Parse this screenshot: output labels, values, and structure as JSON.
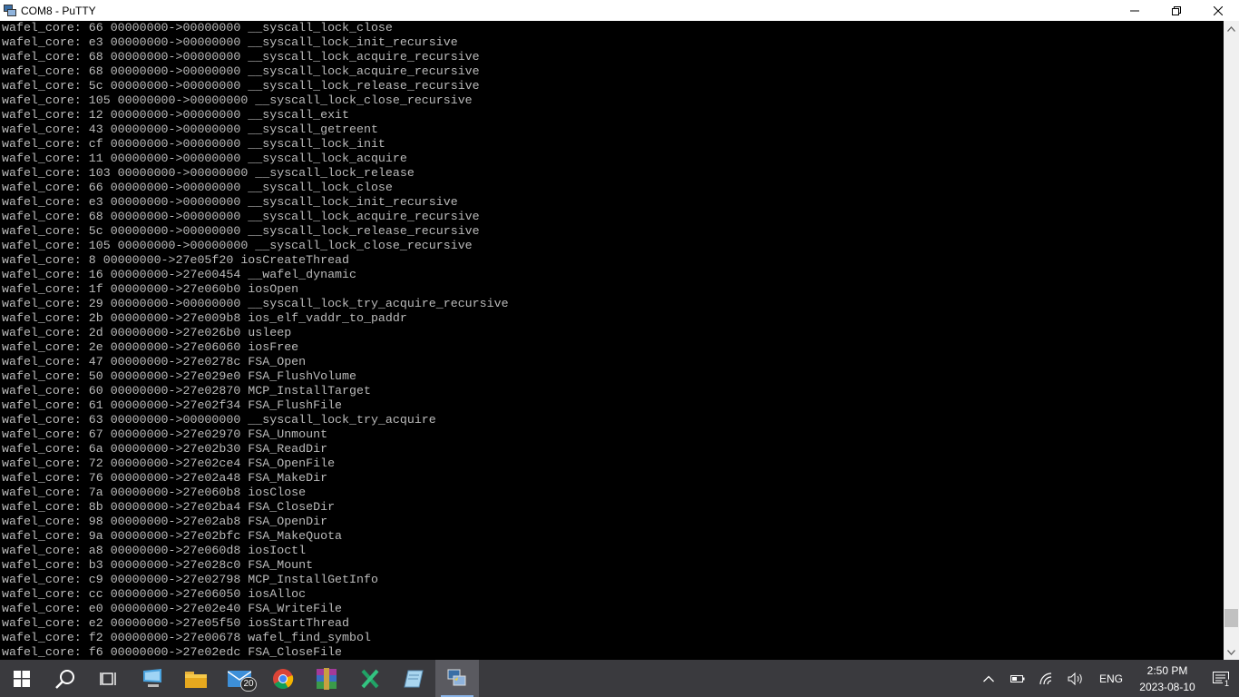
{
  "window": {
    "title": "COM8 - PuTTY",
    "icon": "putty-icon",
    "controls": [
      "minimize-icon",
      "restore-icon",
      "close-icon"
    ]
  },
  "terminal": {
    "text_color": "#bbbbbb",
    "background": "#000000",
    "lines": [
      "wafel_core: 66 00000000->00000000 __syscall_lock_close",
      "wafel_core: e3 00000000->00000000 __syscall_lock_init_recursive",
      "wafel_core: 68 00000000->00000000 __syscall_lock_acquire_recursive",
      "wafel_core: 68 00000000->00000000 __syscall_lock_acquire_recursive",
      "wafel_core: 5c 00000000->00000000 __syscall_lock_release_recursive",
      "wafel_core: 105 00000000->00000000 __syscall_lock_close_recursive",
      "wafel_core: 12 00000000->00000000 __syscall_exit",
      "wafel_core: 43 00000000->00000000 __syscall_getreent",
      "wafel_core: cf 00000000->00000000 __syscall_lock_init",
      "wafel_core: 11 00000000->00000000 __syscall_lock_acquire",
      "wafel_core: 103 00000000->00000000 __syscall_lock_release",
      "wafel_core: 66 00000000->00000000 __syscall_lock_close",
      "wafel_core: e3 00000000->00000000 __syscall_lock_init_recursive",
      "wafel_core: 68 00000000->00000000 __syscall_lock_acquire_recursive",
      "wafel_core: 5c 00000000->00000000 __syscall_lock_release_recursive",
      "wafel_core: 105 00000000->00000000 __syscall_lock_close_recursive",
      "wafel_core: 8 00000000->27e05f20 iosCreateThread",
      "wafel_core: 16 00000000->27e00454 __wafel_dynamic",
      "wafel_core: 1f 00000000->27e060b0 iosOpen",
      "wafel_core: 29 00000000->00000000 __syscall_lock_try_acquire_recursive",
      "wafel_core: 2b 00000000->27e009b8 ios_elf_vaddr_to_paddr",
      "wafel_core: 2d 00000000->27e026b0 usleep",
      "wafel_core: 2e 00000000->27e06060 iosFree",
      "wafel_core: 47 00000000->27e0278c FSA_Open",
      "wafel_core: 50 00000000->27e029e0 FSA_FlushVolume",
      "wafel_core: 60 00000000->27e02870 MCP_InstallTarget",
      "wafel_core: 61 00000000->27e02f34 FSA_FlushFile",
      "wafel_core: 63 00000000->00000000 __syscall_lock_try_acquire",
      "wafel_core: 67 00000000->27e02970 FSA_Unmount",
      "wafel_core: 6a 00000000->27e02b30 FSA_ReadDir",
      "wafel_core: 72 00000000->27e02ce4 FSA_OpenFile",
      "wafel_core: 76 00000000->27e02a48 FSA_MakeDir",
      "wafel_core: 7a 00000000->27e060b8 iosClose",
      "wafel_core: 8b 00000000->27e02ba4 FSA_CloseDir",
      "wafel_core: 98 00000000->27e02ab8 FSA_OpenDir",
      "wafel_core: 9a 00000000->27e02bfc FSA_MakeQuota",
      "wafel_core: a8 00000000->27e060d8 iosIoctl",
      "wafel_core: b3 00000000->27e028c0 FSA_Mount",
      "wafel_core: c9 00000000->27e02798 MCP_InstallGetInfo",
      "wafel_core: cc 00000000->27e06050 iosAlloc",
      "wafel_core: e0 00000000->27e02e40 FSA_WriteFile",
      "wafel_core: e2 00000000->27e05f50 iosStartThread",
      "wafel_core: f2 00000000->27e00678 wafel_find_symbol",
      "wafel_core: f6 00000000->27e02edc FSA_CloseFile"
    ]
  },
  "scrollbar": {
    "position_fraction": 0.97
  },
  "taskbar": {
    "apps": [
      {
        "icon": "windows-start-icon",
        "active": false,
        "open": false
      },
      {
        "icon": "search-icon",
        "active": false,
        "open": false
      },
      {
        "icon": "task-view-icon",
        "active": false,
        "open": false
      },
      {
        "icon": "this-pc-icon",
        "active": false,
        "open": false
      },
      {
        "icon": "file-explorer-icon",
        "active": false,
        "open": false
      },
      {
        "icon": "mail-icon",
        "active": false,
        "open": false,
        "badge": "20"
      },
      {
        "icon": "chrome-icon",
        "active": false,
        "open": false
      },
      {
        "icon": "winrar-icon",
        "active": false,
        "open": false
      },
      {
        "icon": "excel-icon",
        "active": false,
        "open": false
      },
      {
        "icon": "notepad-icon",
        "active": false,
        "open": false
      },
      {
        "icon": "putty-icon",
        "active": true,
        "open": true
      }
    ],
    "tray": {
      "language": "ENG",
      "time": "2:50 PM",
      "date": "2023-08-10",
      "notification_count": "1"
    }
  }
}
